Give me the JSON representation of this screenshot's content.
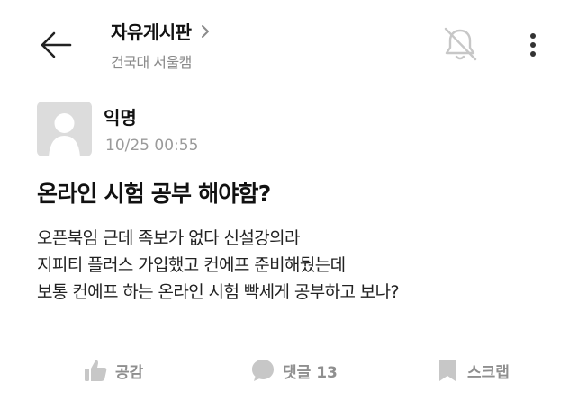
{
  "header": {
    "board_title": "자유게시판",
    "board_subtitle": "건국대 서울캠"
  },
  "post": {
    "author_name": "익명",
    "time": "10/25 00:55",
    "title": "온라인 시험 공부 해야함?",
    "body_lines": [
      "오픈북임 근데 족보가 없다 신설강의라",
      "지피티 플러스 가입했고 컨에프 준비해뒀는데",
      "보통 컨에프 하는 온라인 시험 빡세게 공부하고 보나?"
    ]
  },
  "actions": {
    "like_label": "공감",
    "comment_label": "댓글 13",
    "scrap_label": "스크랩"
  },
  "icons": {
    "back": "arrow-left-icon",
    "chevron": "chevron-right-icon",
    "notification": "bell-off-icon",
    "more": "more-vertical-icon",
    "avatar": "anonymous-avatar-icon",
    "like": "thumbs-up-icon",
    "comment": "comment-bubble-icon",
    "scrap": "bookmark-icon"
  },
  "colors": {
    "text": "#111111",
    "muted": "#8a8a8a",
    "action": "#8f8f8f",
    "icon_light": "#c7c7c7",
    "avatar_bg": "#dcdcdc"
  }
}
